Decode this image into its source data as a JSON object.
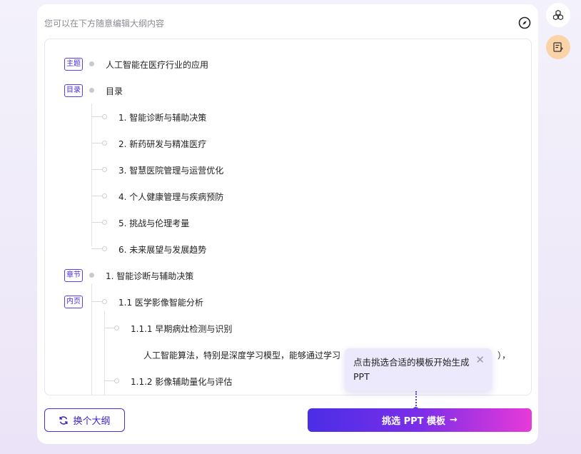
{
  "hint": "您可以在下方随意编辑大纲内容",
  "outline": {
    "topic": {
      "badge": "主题",
      "text": "人工智能在医疗行业的应用"
    },
    "toc": {
      "badge": "目录",
      "text": "目录"
    },
    "toc_items": [
      "1. 智能诊断与辅助决策",
      "2. 新药研发与精准医疗",
      "3. 智慧医院管理与运营优化",
      "4. 个人健康管理与疾病预防",
      "5. 挑战与伦理考量",
      "6. 未来展望与发展趋势"
    ],
    "chapter": {
      "badge": "章节",
      "text": "1. 智能诊断与辅助决策"
    },
    "page": {
      "badge": "内页",
      "text": "1.1 医学影像智能分析"
    },
    "sub1": "1.1.1 早期病灶检测与识别",
    "paragraph": "人工智能算法，特别是深度学习模型，能够通过学习",
    "paragraph_tail": "），",
    "sub2": "1.1.2 影像辅助量化与评估"
  },
  "tooltip": {
    "text": "点击挑选合适的模板开始生成PPT",
    "close": "✕"
  },
  "buttons": {
    "switch_outline": "换个大纲",
    "pick_template": "挑选 PPT 模板",
    "pick_template_arrow": "→"
  },
  "icons": {
    "compass": "compass-icon",
    "cubes": "cubes-icon",
    "outline_doc": "outline-doc-icon",
    "refresh": "refresh-icon"
  },
  "colors": {
    "accent": "#4a2ee0",
    "gradient_end": "#e83ad8",
    "side_active": "#fbd3a8"
  }
}
